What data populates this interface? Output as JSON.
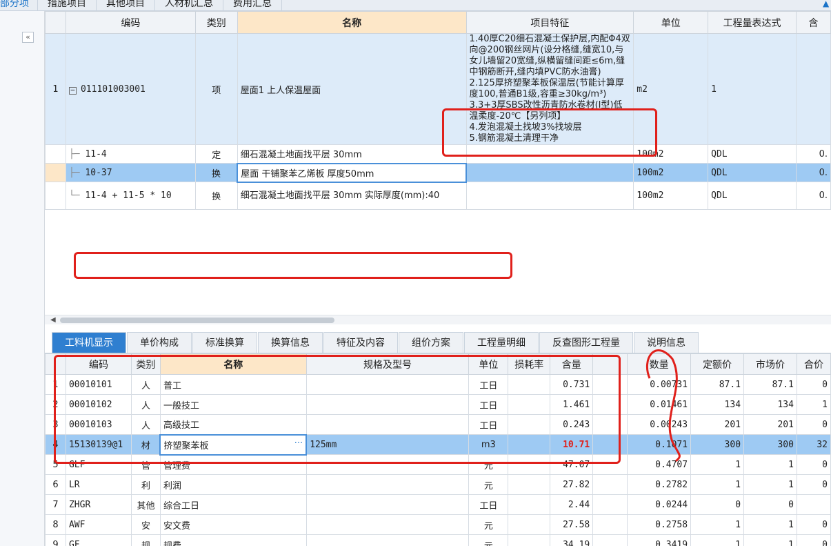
{
  "top_tabs": [
    "部分项",
    "措施项目",
    "其他项目",
    "人材机汇总",
    "费用汇总"
  ],
  "upper_headers": [
    "编码",
    "类别",
    "名称",
    "项目特征",
    "单位",
    "工程量表达式",
    "含"
  ],
  "upper_rows": [
    {
      "no": "1",
      "code": "011101003001",
      "type": "项",
      "name": "屋面1 上人保温屋面",
      "feature": "1.40厚C20细石混凝土保护层,内配Φ4双向@200钢丝网片(设分格缝,缝宽10,与女儿墙留20宽缝,纵横留缝间距≤6m,缝中钢筋断开,缝内填PVC防水油膏)\n2.125厚挤塑聚苯板保温层(节能计算厚度100,普通B1级,容重≥30kg/m³)\n3.3+3厚SBS改性沥青防水卷材(Ⅰ型)低温柔度-20℃【另列项】\n4.发泡混凝土找坡3%找坡层\n5.钢筋混凝土清理干净",
      "unit": "m2",
      "expr": "1",
      "qty": ""
    },
    {
      "no": "",
      "code": "11-4",
      "type": "定",
      "name": "细石混凝土地面找平层 30mm",
      "feature": "",
      "unit": "100m2",
      "expr": "QDL",
      "qty": "0."
    },
    {
      "no": "",
      "code": "10-37",
      "type": "换",
      "name": "屋面 干铺聚苯乙烯板 厚度50mm",
      "feature": "",
      "unit": "100m2",
      "expr": "QDL",
      "qty": "0."
    },
    {
      "no": "",
      "code": "11-4 + 11-5 * 10",
      "type": "换",
      "name": "细石混凝土地面找平层 30mm 实际厚度(mm):40",
      "feature": "",
      "unit": "100m2",
      "expr": "QDL",
      "qty": "0."
    }
  ],
  "lower_tabs": [
    "工料机显示",
    "单价构成",
    "标准换算",
    "换算信息",
    "特征及内容",
    "组价方案",
    "工程量明细",
    "反查图形工程量",
    "说明信息"
  ],
  "lower_headers": [
    "编码",
    "类别",
    "名称",
    "规格及型号",
    "单位",
    "损耗率",
    "含量",
    "数量",
    "定额价",
    "市场价",
    "合价"
  ],
  "lower_rows": [
    {
      "no": "1",
      "code": "00010101",
      "type": "人",
      "name": "普工",
      "spec": "",
      "unit": "工日",
      "loss": "",
      "content": "0.731",
      "qty": "0.00731",
      "price": "87.1",
      "market": "87.1",
      "total": "0"
    },
    {
      "no": "2",
      "code": "00010102",
      "type": "人",
      "name": "一般技工",
      "spec": "",
      "unit": "工日",
      "loss": "",
      "content": "1.461",
      "qty": "0.01461",
      "price": "134",
      "market": "134",
      "total": "1"
    },
    {
      "no": "3",
      "code": "00010103",
      "type": "人",
      "name": "高级技工",
      "spec": "",
      "unit": "工日",
      "loss": "",
      "content": "0.243",
      "qty": "0.00243",
      "price": "201",
      "market": "201",
      "total": "0"
    },
    {
      "no": "4",
      "code": "15130139@1",
      "type": "材",
      "name": "挤塑聚苯板",
      "spec": "125mm",
      "unit": "m3",
      "loss": "",
      "content": "10.71",
      "qty": "0.1071",
      "price": "300",
      "market": "300",
      "total": "32"
    },
    {
      "no": "5",
      "code": "GLF",
      "type": "管",
      "name": "管理费",
      "spec": "",
      "unit": "元",
      "loss": "",
      "content": "47.07",
      "qty": "0.4707",
      "price": "1",
      "market": "1",
      "total": "0"
    },
    {
      "no": "6",
      "code": "LR",
      "type": "利",
      "name": "利润",
      "spec": "",
      "unit": "元",
      "loss": "",
      "content": "27.82",
      "qty": "0.2782",
      "price": "1",
      "market": "1",
      "total": "0"
    },
    {
      "no": "7",
      "code": "ZHGR",
      "type": "其他",
      "name": "综合工日",
      "spec": "",
      "unit": "工日",
      "loss": "",
      "content": "2.44",
      "qty": "0.0244",
      "price": "0",
      "market": "0",
      "total": ""
    },
    {
      "no": "8",
      "code": "AWF",
      "type": "安",
      "name": "安文费",
      "spec": "",
      "unit": "元",
      "loss": "",
      "content": "27.58",
      "qty": "0.2758",
      "price": "1",
      "market": "1",
      "total": "0"
    },
    {
      "no": "9",
      "code": "GF",
      "type": "规",
      "name": "规费",
      "spec": "",
      "unit": "元",
      "loss": "",
      "content": "34.19",
      "qty": "0.3419",
      "price": "1",
      "market": "1",
      "total": "0"
    }
  ],
  "colors": {
    "accent": "#2f7fd0",
    "selected_row": "#9ecaf3",
    "annotation": "#e0201b"
  }
}
